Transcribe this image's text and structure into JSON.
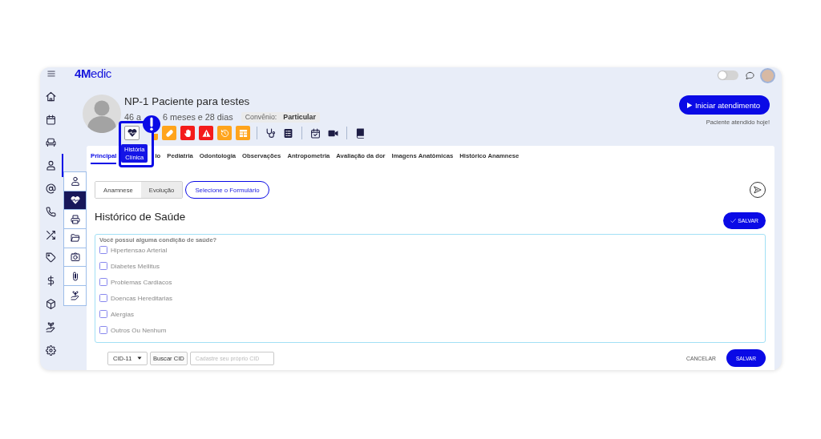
{
  "sidebar": {
    "items": [
      {
        "selected": false
      },
      {
        "selected": false
      },
      {
        "selected": false
      },
      {
        "selected": true
      },
      {
        "selected": false
      },
      {
        "selected": false
      },
      {
        "selected": false
      },
      {
        "selected": false
      },
      {
        "selected": false
      },
      {
        "selected": false
      },
      {
        "selected": false
      },
      {
        "selected": false
      }
    ]
  },
  "header": {
    "logo": "**4M**edic",
    "theme_toggle": {
      "on": false
    }
  },
  "patient": {
    "name": "NP-1 Paciente para testes",
    "age_fragments": [
      "46 a",
      "6 meses e 28 dias"
    ],
    "insurance": {
      "label": "Convênio:",
      "value": "Particular"
    },
    "tiles": [
      {
        "color": "#ffa41c"
      },
      {
        "color": "#ffa41c"
      },
      {
        "color": "#f41b1b"
      },
      {
        "color": "#f41b1b"
      },
      {
        "color": "#ffa41c"
      },
      {
        "color": "#ffa41c"
      }
    ]
  },
  "highlight": {
    "tooltip": "História Clínica"
  },
  "attendance": {
    "button": "Iniciar atendimento",
    "note": "Paciente atendido hoje!"
  },
  "submenu": {
    "items": [
      {
        "selected": false
      },
      {
        "selected": true
      },
      {
        "selected": false
      },
      {
        "selected": false
      },
      {
        "selected": false
      },
      {
        "selected": false
      },
      {
        "selected": false
      }
    ]
  },
  "tabs": [
    {
      "label": "Principal",
      "selected": true
    },
    {
      "label": "io",
      "selected": false
    },
    {
      "label": "Pediatria",
      "selected": false
    },
    {
      "label": "Odontologia",
      "selected": false
    },
    {
      "label": "Observações",
      "selected": false
    },
    {
      "label": "Antropometria",
      "selected": false
    },
    {
      "label": "Avaliação da dor",
      "selected": false
    },
    {
      "label": "Imagens Anatômicas",
      "selected": false
    },
    {
      "label": "Histórico Anamnese",
      "selected": false
    }
  ],
  "subtabs": [
    {
      "label": "Anamnese",
      "selected": true
    },
    {
      "label": "Evolução",
      "selected": false
    }
  ],
  "form_picker": "Selecione o Formulário",
  "section": {
    "title": "Histórico de Saúde",
    "save_button": "SALVAR",
    "question": "Você possui alguma condição de saúde?",
    "options": [
      {
        "label": "Hipertensao Arterial",
        "checked": false
      },
      {
        "label": "Diabetes Mellitus",
        "checked": false
      },
      {
        "label": "Problemas Cardiacos",
        "checked": false
      },
      {
        "label": "Doencas Hereditarias",
        "checked": false
      },
      {
        "label": "Alergias",
        "checked": false
      },
      {
        "label": "Outros Ou Nenhum",
        "checked": false
      }
    ]
  },
  "footer": {
    "cid_select": "CID-11",
    "search_button": "Buscar CID",
    "cid_input": {
      "placeholder": "Cadastre seu próprio CID"
    },
    "cancel_button": "CANCELAR",
    "save_button": "SALVAR"
  }
}
